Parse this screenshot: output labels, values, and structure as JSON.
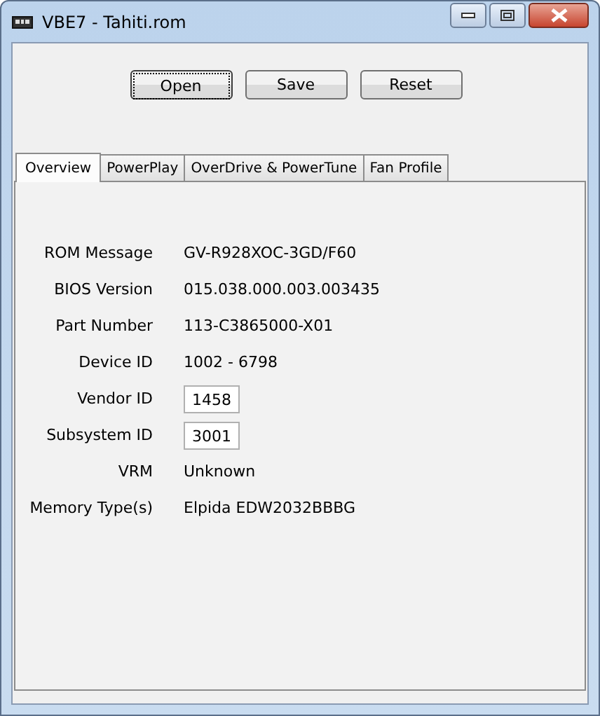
{
  "window": {
    "title": "VBE7 - Tahiti.rom"
  },
  "buttons": [
    {
      "label": "Open",
      "focused": true
    },
    {
      "label": "Save",
      "focused": false
    },
    {
      "label": "Reset",
      "focused": false
    }
  ],
  "tabs": [
    {
      "label": "Overview",
      "selected": true
    },
    {
      "label": "PowerPlay",
      "selected": false
    },
    {
      "label": "OverDrive & PowerTune",
      "selected": false
    },
    {
      "label": "Fan Profile",
      "selected": false
    }
  ],
  "fields": [
    {
      "kind": "text",
      "label": "ROM Message",
      "value": "GV-R928XOC-3GD/F60"
    },
    {
      "kind": "text",
      "label": "BIOS Version",
      "value": "015.038.000.003.003435"
    },
    {
      "kind": "text",
      "label": "Part Number",
      "value": "113-C3865000-X01"
    },
    {
      "kind": "text",
      "label": "Device ID",
      "value": "1002 - 6798"
    },
    {
      "kind": "input",
      "label": "Vendor ID",
      "value": "1458"
    },
    {
      "kind": "input",
      "label": "Subsystem ID",
      "value": "3001"
    },
    {
      "kind": "text",
      "label": "VRM",
      "value": "Unknown"
    },
    {
      "kind": "text",
      "label": "Memory Type(s)",
      "value": "Elpida EDW2032BBBG"
    }
  ]
}
